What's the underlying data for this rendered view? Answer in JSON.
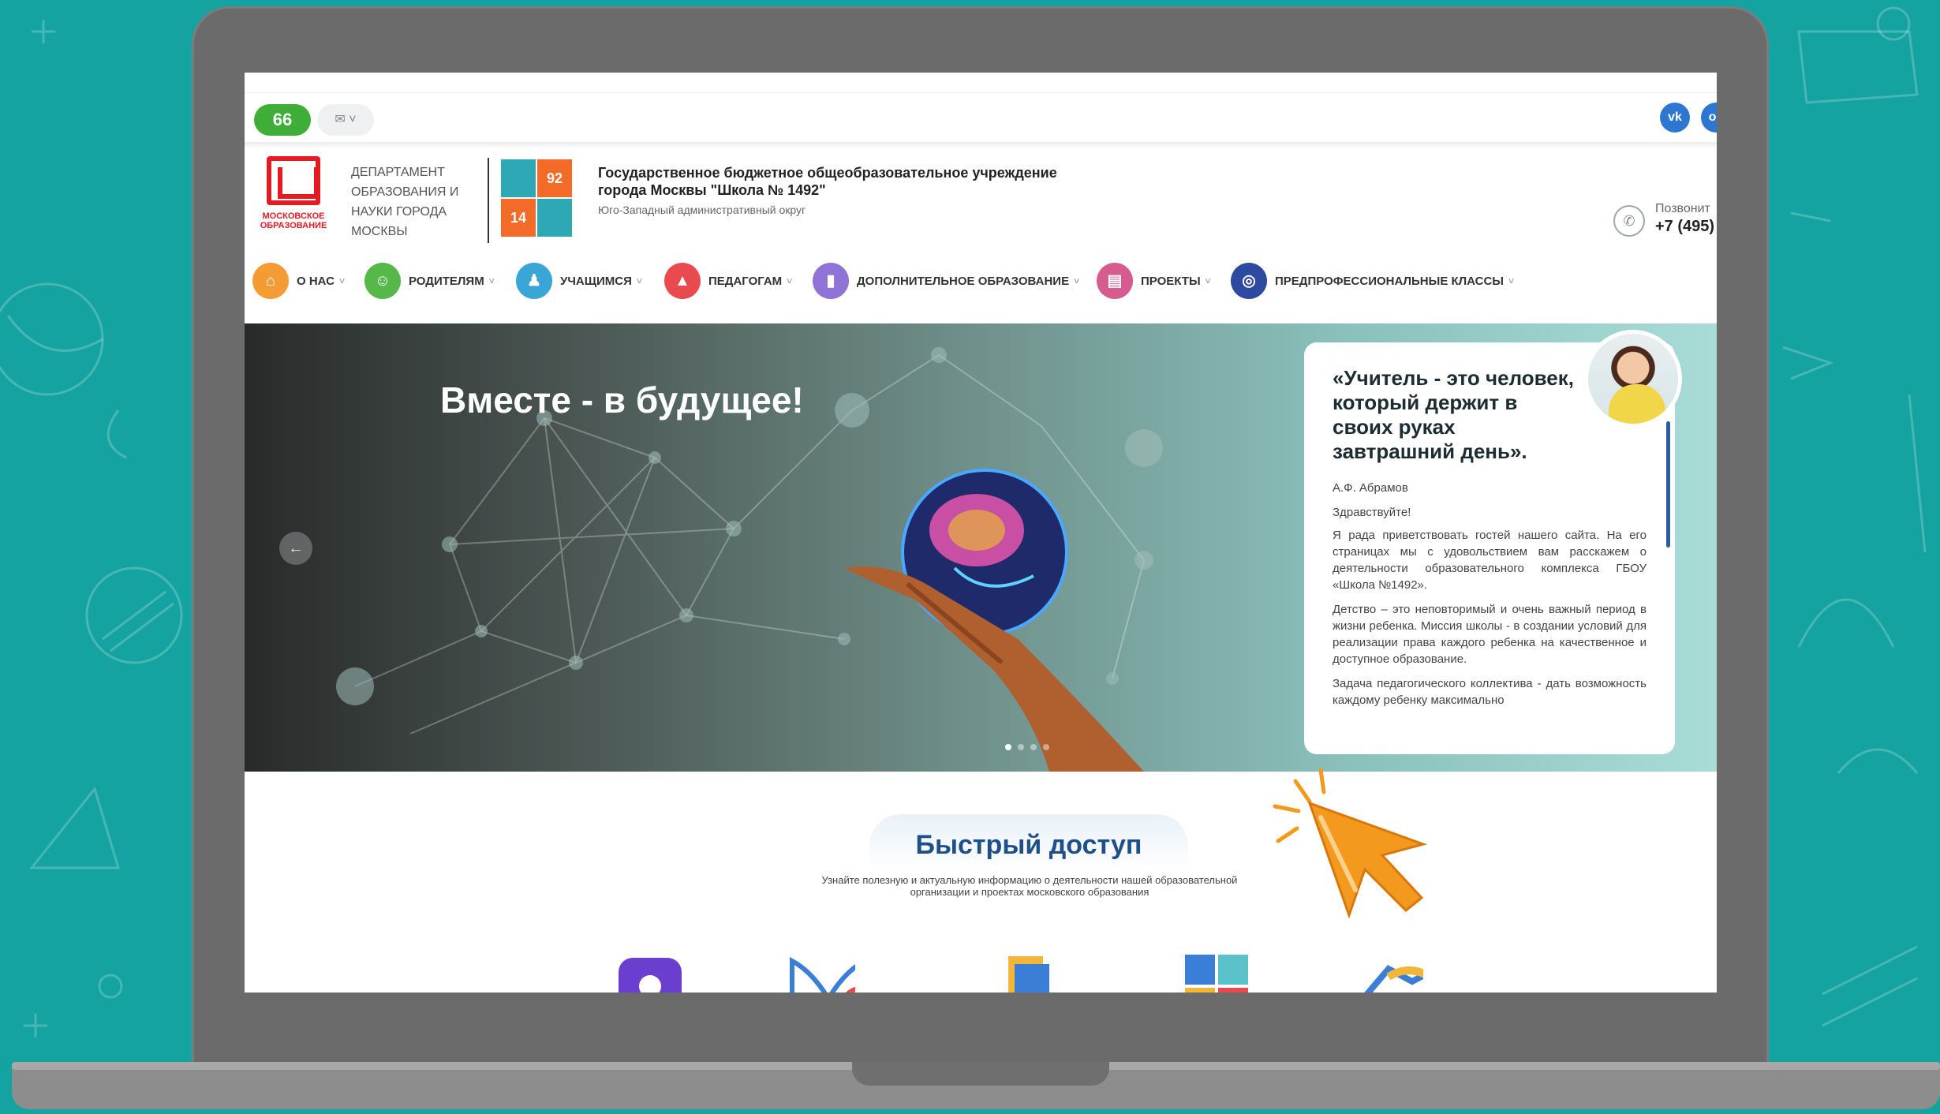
{
  "toolbar": {
    "accessibility_label": "66",
    "language_label": "✉ ˅",
    "social": [
      "vk",
      "ok"
    ]
  },
  "header": {
    "mos_logo_text": "МОСКОВСКОЕ ОБРАЗОВАНИЕ",
    "department": "Департамент образования и науки города Москвы",
    "school_logo_numbers": [
      "92",
      "14"
    ],
    "school_name_line1": "Государственное бюджетное общеобразовательное учреждение",
    "school_name_line2": "города Москвы \"Школа № 1492\"",
    "district": "Юго-Западный административный округ",
    "phone_label": "Позвонит",
    "phone_number": "+7 (495)"
  },
  "nav": {
    "items": [
      {
        "label": "О НАС",
        "icon": "home-icon",
        "color": "#f39c33"
      },
      {
        "label": "РОДИТЕЛЯМ",
        "icon": "family-icon",
        "color": "#55b848"
      },
      {
        "label": "УЧАЩИМСЯ",
        "icon": "students-icon",
        "color": "#3aa6d8"
      },
      {
        "label": "ПЕДАГОГАМ",
        "icon": "graduation-cap-icon",
        "color": "#e94a4f"
      },
      {
        "label": "ДОПОЛНИТЕЛЬНОЕ ОБРАЗОВАНИЕ",
        "icon": "book-icon",
        "color": "#8f73d6"
      },
      {
        "label": "ПРОЕКТЫ",
        "icon": "chart-icon",
        "color": "#d65b8f"
      },
      {
        "label": "ПРЕДПРОФЕССИОНАЛЬНЫЕ КЛАССЫ",
        "icon": "globe-icon",
        "color": "#2e4aa0"
      }
    ]
  },
  "hero": {
    "title": "Вместе - в будущее!",
    "prev_label": "←",
    "quote": "«Учитель - это человек, который держит в своих руках завтрашний день».",
    "author": "А.Ф. Абрамов",
    "greeting": "Здравствуйте!",
    "paragraphs": [
      "Я рада приветствовать гостей нашего сайта. На его страницах мы с удовольствием вам расскажем о деятельности образовательного комплекса ГБОУ «Школа №1492».",
      "Детство – это неповторимый и очень важный период в жизни ребенка. Миссия школы - в создании условий для реализации права каждого ребенка на качественное и доступное образование.",
      "Задача педагогического коллектива - дать возможность каждому ребенку максимально"
    ]
  },
  "quick_access": {
    "title": "Быстрый доступ",
    "subtitle": "Узнайте полезную и актуальную информацию о деятельности нашей образовательной организации и проектах московского образования",
    "icons": [
      "user-lock-icon",
      "wifi-book-icon",
      "documents-icon",
      "contacts-icon",
      "handshake-icon"
    ]
  },
  "colors": {
    "background": "#14a3a1",
    "accent_blue": "#1d4f8a",
    "cursor_orange": "#f39a1e"
  }
}
